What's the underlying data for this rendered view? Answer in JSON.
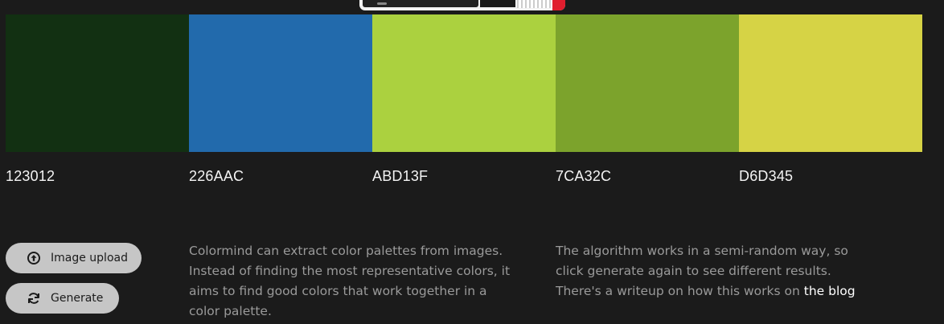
{
  "palette": [
    {
      "hex": "123012",
      "color": "#123012"
    },
    {
      "hex": "226AAC",
      "color": "#226AAC"
    },
    {
      "hex": "ABD13F",
      "color": "#ABD13F"
    },
    {
      "hex": "7CA32C",
      "color": "#7CA32C"
    },
    {
      "hex": "D6D345",
      "color": "#D6D345"
    }
  ],
  "buttons": {
    "upload_label": "Image upload",
    "upload_icon": "upload-circle-icon",
    "generate_label": "Generate",
    "generate_icon": "refresh-icon"
  },
  "description": {
    "left": "Colormind can extract color palettes from images. Instead of finding the most representative colors, it aims to find good colors that work together in a color palette.",
    "right_text": "The algorithm works in a semi-random way, so click generate again to see different results. There's a writeup on how this works on ",
    "right_link": "the blog"
  },
  "colors": {
    "background": "#1b1b1b",
    "button_bg": "#c6c6c6",
    "body_text": "#9a9a9a",
    "hex_text": "#f4f4f4"
  }
}
